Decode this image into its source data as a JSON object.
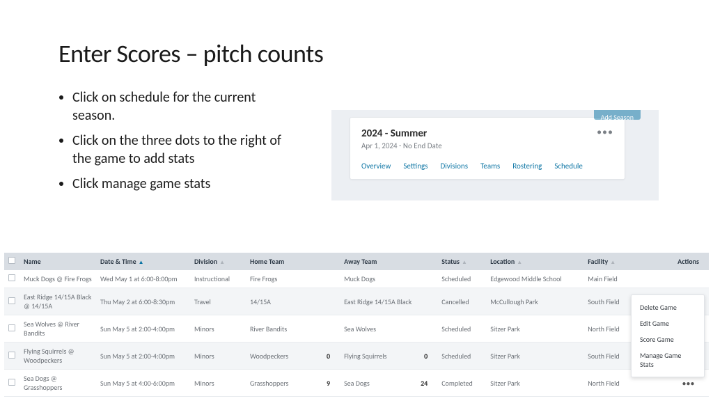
{
  "slide": {
    "title": "Enter Scores – pitch counts",
    "bullets": [
      "Click on schedule for the current season.",
      "Click on the three dots to the right of the game to add stats",
      "Click manage game stats"
    ]
  },
  "season_card": {
    "primary_button": "Add Season",
    "title": "2024 - Summer",
    "dates": "Apr 1, 2024 - No End Date",
    "dots": "•••",
    "tabs": [
      "Overview",
      "Settings",
      "Divisions",
      "Teams",
      "Rostering",
      "Schedule"
    ]
  },
  "table": {
    "headers": {
      "name": "Name",
      "datetime": "Date & Time",
      "division": "Division",
      "home": "Home Team",
      "away": "Away Team",
      "status": "Status",
      "location": "Location",
      "facility": "Facility",
      "actions": "Actions"
    },
    "rows": [
      {
        "name": "Muck Dogs @ Fire Frogs",
        "datetime": "Wed May 1 at 6:00-8:00pm",
        "division": "Instructional",
        "home": "Fire Frogs",
        "home_score": "",
        "away": "Muck Dogs",
        "away_score": "",
        "status": "Scheduled",
        "location": "Edgewood Middle School",
        "facility": "Main Field"
      },
      {
        "name": "East Ridge 14/15A Black @ 14/15A",
        "datetime": "Thu May 2 at 6:00-8:30pm",
        "division": "Travel",
        "home": "14/15A",
        "home_score": "",
        "away": "East Ridge 14/15A Black",
        "away_score": "",
        "status": "Cancelled",
        "location": "McCullough Park",
        "facility": "South Field"
      },
      {
        "name": "Sea Wolves @ River Bandits",
        "datetime": "Sun May 5 at 2:00-4:00pm",
        "division": "Minors",
        "home": "River Bandits",
        "home_score": "",
        "away": "Sea Wolves",
        "away_score": "",
        "status": "Scheduled",
        "location": "Sitzer Park",
        "facility": "North Field"
      },
      {
        "name": "Flying Squirrels @ Woodpeckers",
        "datetime": "Sun May 5 at 2:00-4:00pm",
        "division": "Minors",
        "home": "Woodpeckers",
        "home_score": "0",
        "away": "Flying Squirrels",
        "away_score": "0",
        "status": "Scheduled",
        "location": "Sitzer Park",
        "facility": "South Field"
      },
      {
        "name": "Sea Dogs @ Grasshoppers",
        "datetime": "Sun May 5 at 4:00-6:00pm",
        "division": "Minors",
        "home": "Grasshoppers",
        "home_score": "9",
        "away": "Sea Dogs",
        "away_score": "24",
        "status": "Completed",
        "location": "Sitzer Park",
        "facility": "North Field"
      }
    ],
    "row_actions_glyph": "•••"
  },
  "action_popup": {
    "items": [
      "Delete Game",
      "Edit Game",
      "Score Game",
      "Manage Game Stats"
    ]
  }
}
